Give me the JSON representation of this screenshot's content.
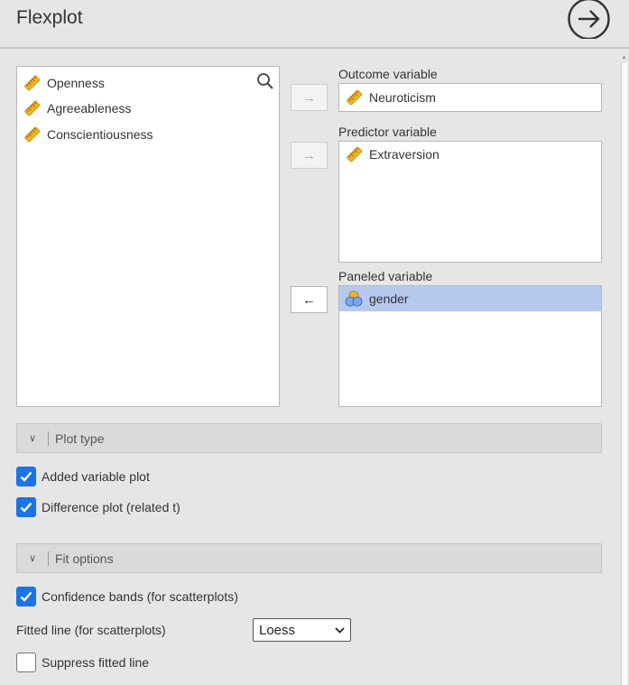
{
  "header": {
    "title": "Flexplot"
  },
  "available_variables": {
    "items": [
      {
        "label": "Openness",
        "icon": "ruler-icon"
      },
      {
        "label": "Agreeableness",
        "icon": "ruler-icon"
      },
      {
        "label": "Conscientiousness",
        "icon": "ruler-icon"
      }
    ]
  },
  "outcome": {
    "label": "Outcome variable",
    "value": "Neuroticism"
  },
  "predictor": {
    "label": "Predictor variable",
    "items": [
      "Extraversion"
    ]
  },
  "paneled": {
    "label": "Paneled variable",
    "items": [
      "gender"
    ]
  },
  "plot_type": {
    "header": "Plot type",
    "options": [
      {
        "label": "Added variable plot",
        "checked": true
      },
      {
        "label": "Difference plot (related t)",
        "checked": true
      }
    ]
  },
  "fit_options": {
    "header": "Fit options",
    "confidence_bands": {
      "label": "Confidence bands (for scatterplots)",
      "checked": true
    },
    "fitted_line": {
      "label": "Fitted line (for scatterplots)",
      "value": "Loess"
    },
    "suppress": {
      "label": "Suppress fitted line",
      "checked": false
    }
  },
  "colors": {
    "accent": "#1a73e8",
    "selection": "#b7c9ee",
    "ruler": "#f0b429"
  }
}
